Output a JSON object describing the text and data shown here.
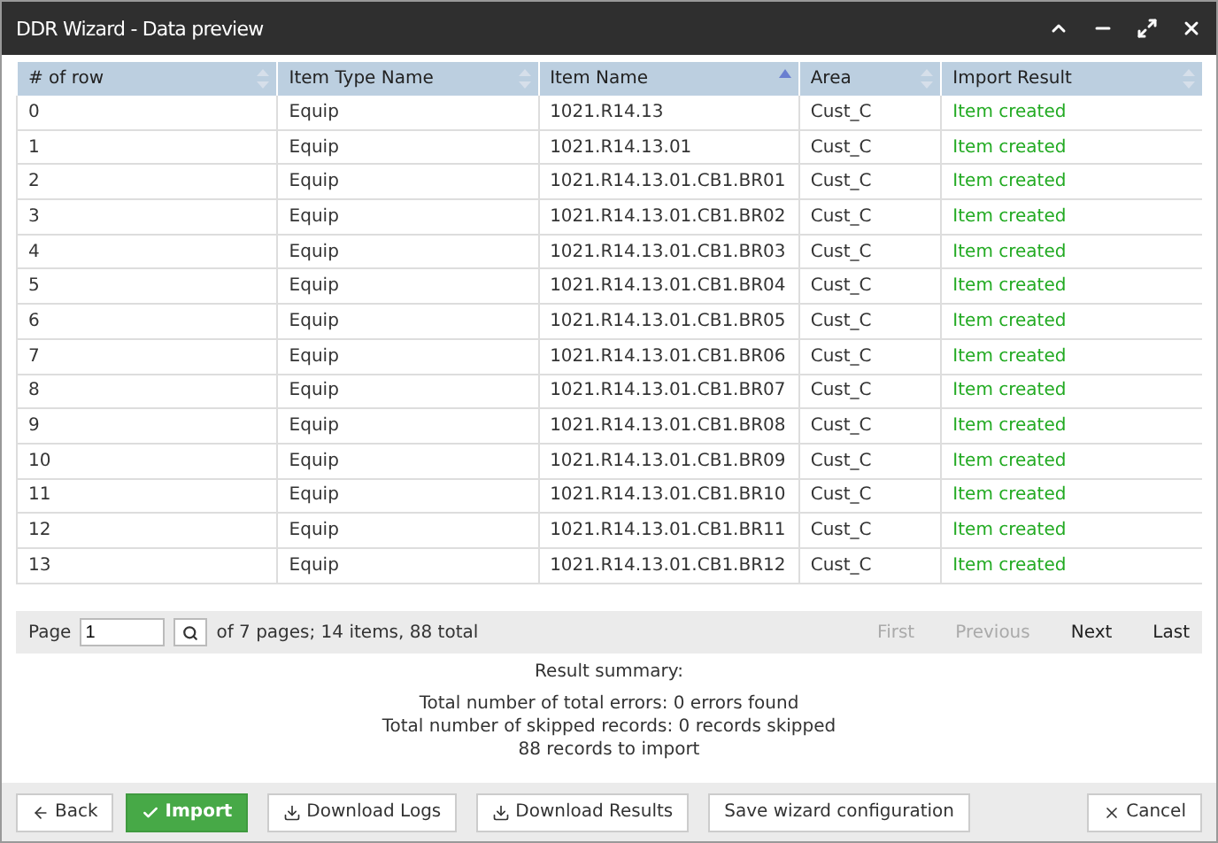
{
  "window": {
    "title": "DDR Wizard - Data preview"
  },
  "table": {
    "columns": [
      {
        "label": "# of row",
        "sorted": false
      },
      {
        "label": "Item Type Name",
        "sorted": false
      },
      {
        "label": "Item Name",
        "sorted": true
      },
      {
        "label": "Area",
        "sorted": false
      },
      {
        "label": "Import Result",
        "sorted": false
      }
    ],
    "rows": [
      [
        "0",
        "Equip",
        "1021.R14.13",
        "Cust_C",
        "Item created"
      ],
      [
        "1",
        "Equip",
        "1021.R14.13.01",
        "Cust_C",
        "Item created"
      ],
      [
        "2",
        "Equip",
        "1021.R14.13.01.CB1.BR01",
        "Cust_C",
        "Item created"
      ],
      [
        "3",
        "Equip",
        "1021.R14.13.01.CB1.BR02",
        "Cust_C",
        "Item created"
      ],
      [
        "4",
        "Equip",
        "1021.R14.13.01.CB1.BR03",
        "Cust_C",
        "Item created"
      ],
      [
        "5",
        "Equip",
        "1021.R14.13.01.CB1.BR04",
        "Cust_C",
        "Item created"
      ],
      [
        "6",
        "Equip",
        "1021.R14.13.01.CB1.BR05",
        "Cust_C",
        "Item created"
      ],
      [
        "7",
        "Equip",
        "1021.R14.13.01.CB1.BR06",
        "Cust_C",
        "Item created"
      ],
      [
        "8",
        "Equip",
        "1021.R14.13.01.CB1.BR07",
        "Cust_C",
        "Item created"
      ],
      [
        "9",
        "Equip",
        "1021.R14.13.01.CB1.BR08",
        "Cust_C",
        "Item created"
      ],
      [
        "10",
        "Equip",
        "1021.R14.13.01.CB1.BR09",
        "Cust_C",
        "Item created"
      ],
      [
        "11",
        "Equip",
        "1021.R14.13.01.CB1.BR10",
        "Cust_C",
        "Item created"
      ],
      [
        "12",
        "Equip",
        "1021.R14.13.01.CB1.BR11",
        "Cust_C",
        "Item created"
      ],
      [
        "13",
        "Equip",
        "1021.R14.13.01.CB1.BR12",
        "Cust_C",
        "Item created"
      ]
    ]
  },
  "pager": {
    "label": "Page",
    "page": "1",
    "info": "of 7 pages; 14 items, 88 total",
    "links": [
      {
        "label": "First",
        "disabled": true
      },
      {
        "label": "Previous",
        "disabled": true
      },
      {
        "label": "Next",
        "disabled": false
      },
      {
        "label": "Last",
        "disabled": false
      }
    ]
  },
  "summary": [
    "Result summary:",
    "Total number of total errors: 0 errors found",
    "Total number of skipped records: 0 records skipped",
    "88 records to import"
  ],
  "buttons": [
    {
      "label": "Back",
      "kind": "back"
    },
    {
      "label": "Import",
      "kind": "primary"
    },
    {
      "label": "Download Logs",
      "kind": "download"
    },
    {
      "label": "Download Results",
      "kind": "download"
    },
    {
      "label": "Save wizard configuration",
      "kind": "plain"
    },
    {
      "label": "Cancel",
      "kind": "cancel"
    }
  ]
}
